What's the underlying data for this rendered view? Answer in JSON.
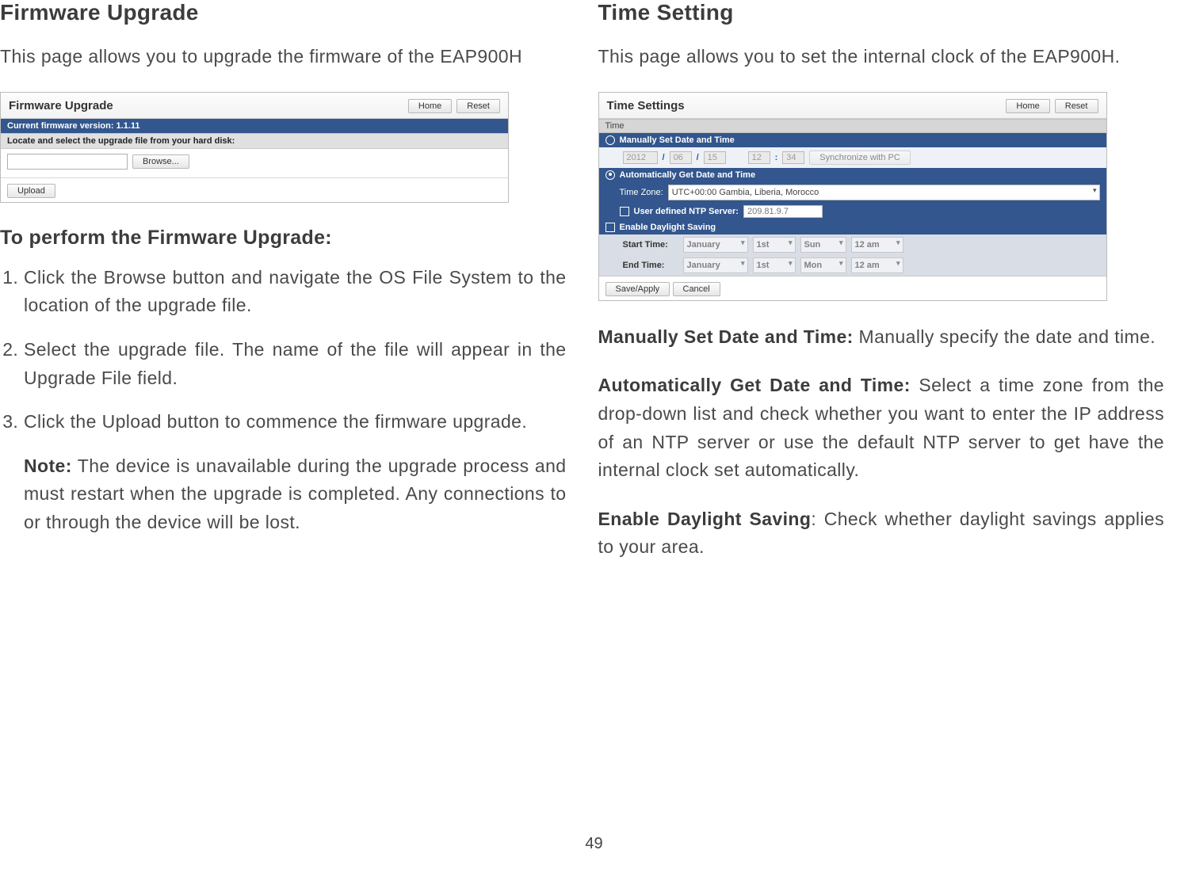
{
  "page_number": "49",
  "left": {
    "title": "Firmware Upgrade",
    "intro": "This page allows you to upgrade the firmware of the EAP900H",
    "panel": {
      "header_title": "Firmware Upgrade",
      "btn_home": "Home",
      "btn_reset": "Reset",
      "current_fw_label": "Current firmware version: 1.1.11",
      "locate_label": "Locate and select the upgrade file from your hard disk:",
      "browse_btn": "Browse...",
      "upload_btn": "Upload"
    },
    "howto_title": "To perform the Firmware Upgrade:",
    "steps": {
      "s1": "Click the Browse button and navigate the OS File System to the location of the upgrade file.",
      "s2": "Select the upgrade file. The name of the file will appear in the Upgrade File field.",
      "s3": "Click the Upload button to commence the firmware upgrade.",
      "note_label": "Note:",
      "note_text": " The device is unavailable during the upgrade process and must restart when the upgrade is completed. Any connections to or through the device will be lost."
    }
  },
  "right": {
    "title": "Time Setting",
    "intro": "This page allows you to set the internal clock of the EAP900H.",
    "panel": {
      "header_title": "Time Settings",
      "btn_home": "Home",
      "btn_reset": "Reset",
      "time_hdr": "Time",
      "manual_label": "Manually Set Date and Time",
      "year": "2012",
      "month": "06",
      "day": "15",
      "hour": "12",
      "minute": "34",
      "sync_pc_btn": "Synchronize with PC",
      "auto_label": "Automatically Get Date and Time",
      "tz_label": "Time Zone:",
      "tz_value": "UTC+00:00 Gambia, Liberia, Morocco",
      "ntp_chk_label": "User defined NTP Server:",
      "ntp_value": "209.81.9.7",
      "dst_label": "Enable Daylight Saving",
      "start_label": "Start Time:",
      "end_label": "End Time:",
      "month_opt": "January",
      "day_opt": "1st",
      "wd1": "Sun",
      "wd2": "Mon",
      "ampm": "12 am",
      "save_btn": "Save/Apply",
      "cancel_btn": "Cancel"
    },
    "para_manual_label": "Manually Set Date and Time:",
    "para_manual_text": " Manually specify the date and time.",
    "para_auto_label": "Automatically Get Date and Time:",
    "para_auto_text": " Select a time zone from the drop-down list and check whether you want to enter the IP address of an NTP server or use the default NTP server to get have the internal clock set automatically.",
    "para_dst_label": "Enable Daylight Saving",
    "para_dst_text": ": Check whether daylight savings applies to your area."
  }
}
